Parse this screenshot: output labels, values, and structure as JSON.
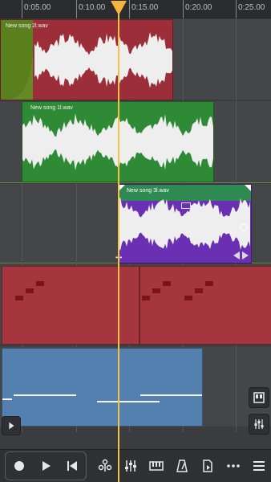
{
  "ruler": {
    "labels": [
      "0:05.00",
      "0:10.00",
      "0:15.00",
      "0:20.00",
      "0:25.00"
    ]
  },
  "tracks": [
    {
      "clip_name": "New song  2l.wav",
      "color": "#9b2e38",
      "fade_color": "#5a7f1d"
    },
    {
      "clip_name": "New song  1l.wav",
      "color": "#2e8a35"
    },
    {
      "clip_name": "New song  3l.wav",
      "color": "#6b2fb3",
      "header_color": "#2e8a50"
    },
    {
      "type": "midi",
      "color": "#a6363d"
    },
    {
      "type": "pattern",
      "color": "#5480b0"
    }
  ],
  "playhead": {
    "color": "#f2c14a"
  },
  "toolbar": {
    "record": "record-icon",
    "play": "play-icon",
    "rewind": "rewind-to-start-icon",
    "fx": "effects-icon",
    "mixer": "mixer-icon",
    "keyboard": "keyboard-icon",
    "metronome": "metronome-icon",
    "export": "export-icon",
    "more": "more-icon",
    "menu": "menu-icon"
  }
}
